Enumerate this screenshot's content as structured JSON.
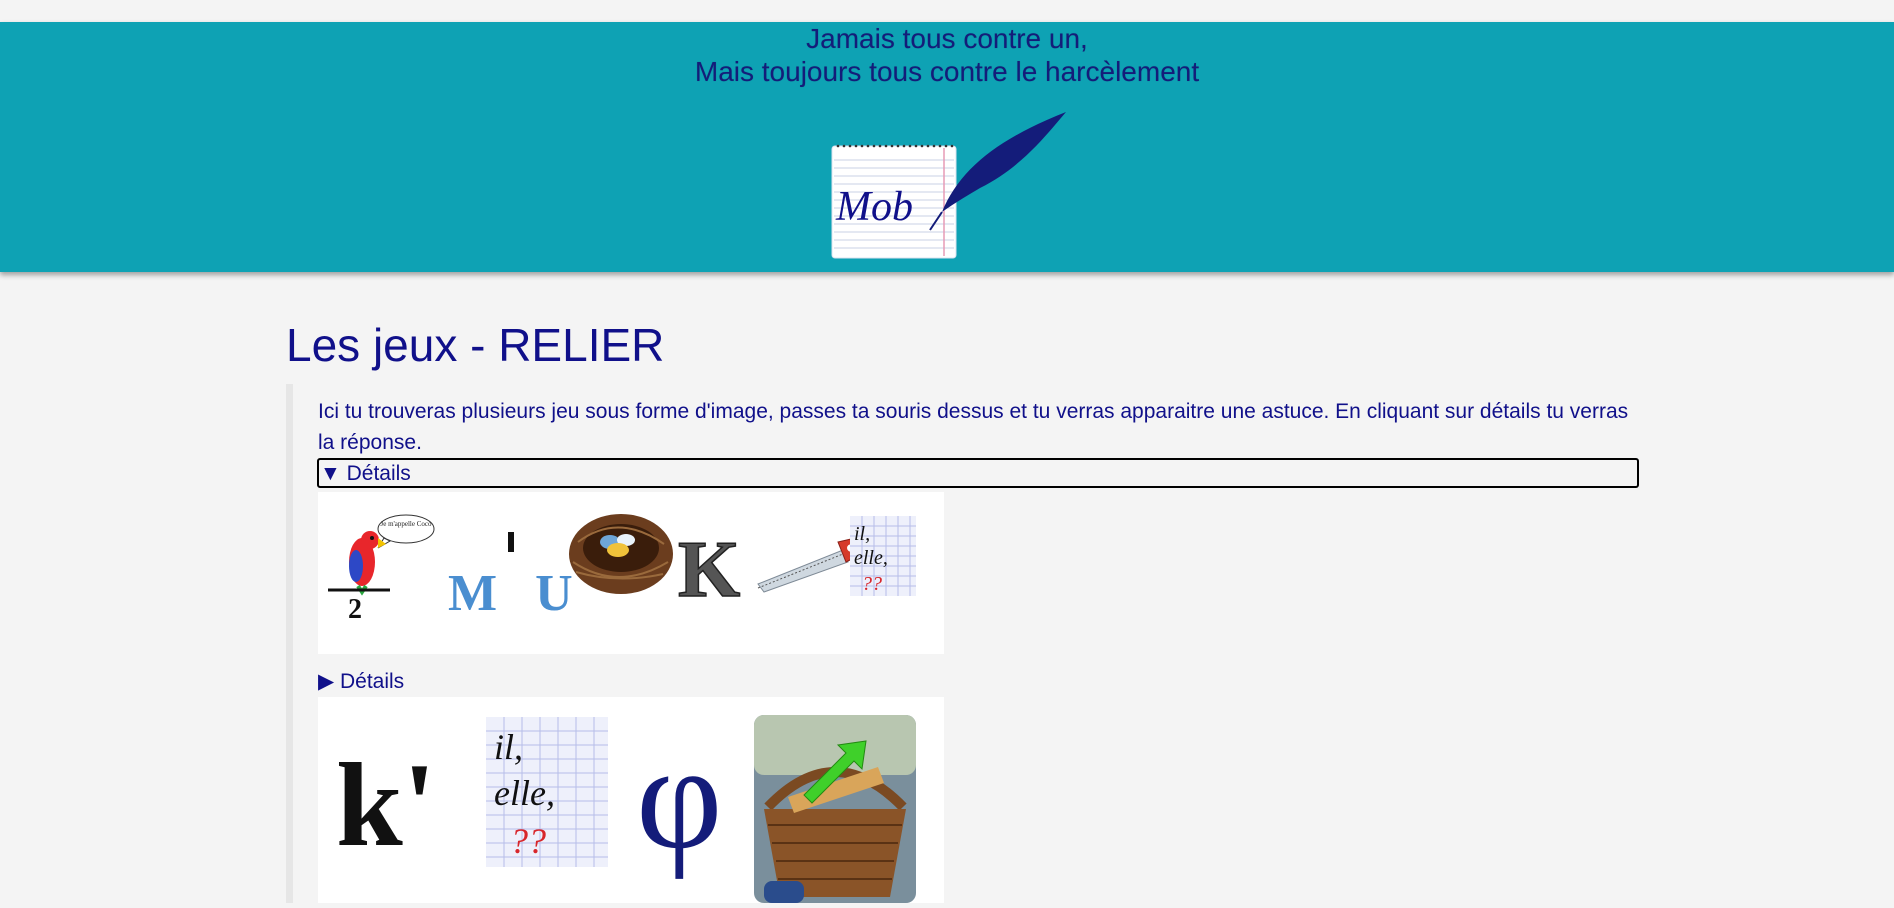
{
  "header": {
    "slogan_line1": "Jamais tous contre un,",
    "slogan_line2": "Mais toujours tous contre le harcèlement",
    "logo_text": "Mob",
    "background": "#0ea2b4",
    "text_color": "#141c7a"
  },
  "main": {
    "title": "Les jeux - RELIER",
    "intro": "Ici tu trouveras plusieurs jeu sous forme d'image, passes ta souris dessus et tu verras apparaitre une astuce. En cliquant sur détails tu verras la réponse.",
    "details": [
      {
        "label": "▼ Détails",
        "state": "open",
        "images": [
          "parrot-icon",
          "mu-letters-icon",
          "nest-icon",
          "letter-k-icon",
          "saw-icon",
          "il-elle-icon"
        ],
        "parrot_bubble": "Je m'appelle Coco",
        "fraction_digit": "2",
        "mu_text": "MU",
        "k_letter": "K",
        "il_elle": [
          "il,",
          "elle,",
          "??"
        ]
      },
      {
        "label": "▶ Détails",
        "state": "closed",
        "images": [
          "k-prime-icon",
          "il-elle-icon",
          "phi-icon",
          "basket-icon"
        ],
        "k_prime": "k'",
        "il_elle": [
          "il,",
          "elle,",
          "??"
        ],
        "phi": "φ"
      }
    ]
  },
  "colors": {
    "text": "#10108a",
    "page_bg": "#f4f4f4"
  }
}
